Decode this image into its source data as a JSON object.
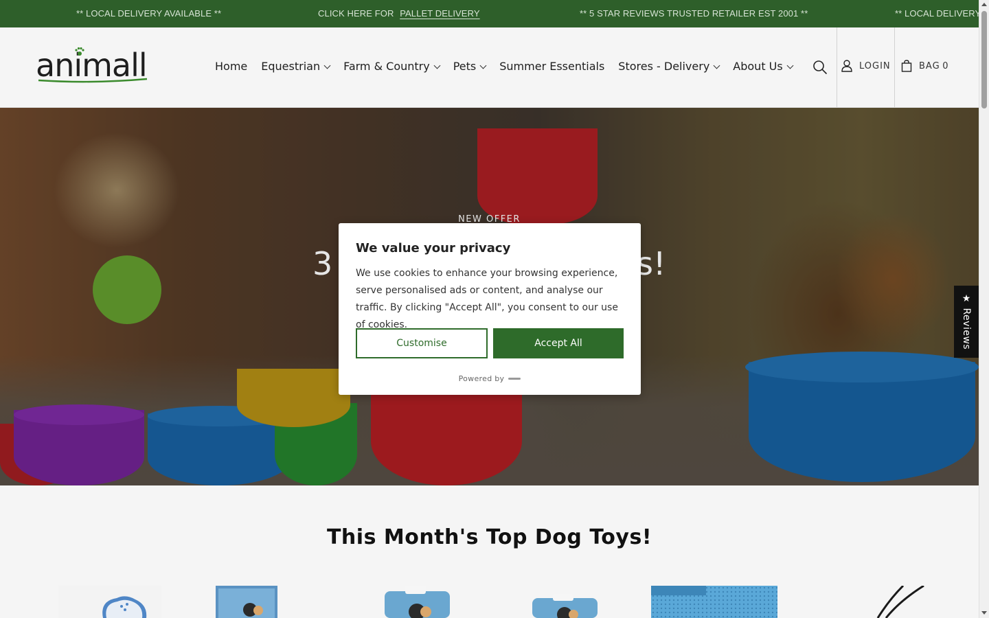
{
  "announcement": {
    "item1": "** LOCAL DELIVERY AVAILABLE **",
    "item2_prefix": "CLICK HERE FOR",
    "item2_link": "PALLET DELIVERY",
    "item3": "** 5 STAR REVIEWS TRUSTED RETAILER EST 2001 **",
    "item4": "** LOCAL DELIVERY A"
  },
  "header": {
    "logo_text": "animall",
    "nav": [
      {
        "label": "Home",
        "dropdown": false
      },
      {
        "label": "Equestrian",
        "dropdown": true
      },
      {
        "label": "Farm & Country",
        "dropdown": true
      },
      {
        "label": "Pets",
        "dropdown": true
      },
      {
        "label": "Summer Essentials",
        "dropdown": false
      },
      {
        "label": "Stores - Delivery",
        "dropdown": true
      },
      {
        "label": "About Us",
        "dropdown": true
      }
    ],
    "login_label": "LOGIN",
    "bag_label": "BAG",
    "bag_count": "0",
    "icons": [
      "search-icon",
      "user-icon",
      "bag-icon"
    ]
  },
  "hero": {
    "eyebrow": "NEW OFFER",
    "title_left": "3",
    "title_right": "s!"
  },
  "reviews_tab": {
    "label": "★ Reviews"
  },
  "section": {
    "title": "This Month's Top Dog Toys!"
  },
  "cookie_modal": {
    "title": "We value your privacy",
    "body": "We use cookies to enhance your browsing experience, serve personalised ads or content, and analyse our traffic. By clicking \"Accept All\", you consent to our use of cookies.",
    "customise_label": "Customise",
    "accept_label": "Accept All",
    "powered_by": "Powered by"
  },
  "colors": {
    "brand_green": "#2e5f2a",
    "button_green": "#2e6b2a",
    "modal_bg": "#ffffff",
    "page_bg": "#f5f5f5"
  }
}
